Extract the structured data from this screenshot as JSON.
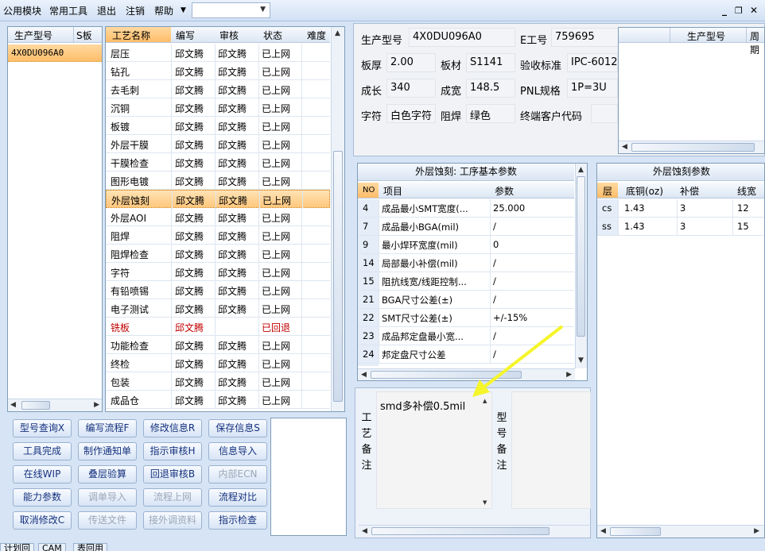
{
  "menubar": {
    "items": [
      "公用模块",
      "常用工具",
      "退出",
      "注销",
      "帮助"
    ],
    "combo_value": ""
  },
  "product_list": {
    "headers": [
      "生产型号",
      "S板"
    ],
    "items": [
      "4X0DU096A0"
    ]
  },
  "process_table": {
    "headers": [
      "工艺名称",
      "编写",
      "审核",
      "状态",
      "难度"
    ],
    "rows": [
      {
        "name": "层压",
        "writer": "邱文腾",
        "reviewer": "邱文腾",
        "status": "已上网"
      },
      {
        "name": "钻孔",
        "writer": "邱文腾",
        "reviewer": "邱文腾",
        "status": "已上网"
      },
      {
        "name": "去毛刺",
        "writer": "邱文腾",
        "reviewer": "邱文腾",
        "status": "已上网"
      },
      {
        "name": "沉铜",
        "writer": "邱文腾",
        "reviewer": "邱文腾",
        "status": "已上网"
      },
      {
        "name": "板镀",
        "writer": "邱文腾",
        "reviewer": "邱文腾",
        "status": "已上网"
      },
      {
        "name": "外层干膜",
        "writer": "邱文腾",
        "reviewer": "邱文腾",
        "status": "已上网"
      },
      {
        "name": "干膜检查",
        "writer": "邱文腾",
        "reviewer": "邱文腾",
        "status": "已上网"
      },
      {
        "name": "图形电镀",
        "writer": "邱文腾",
        "reviewer": "邱文腾",
        "status": "已上网"
      },
      {
        "name": "外层蚀刻",
        "writer": "邱文腾",
        "reviewer": "邱文腾",
        "status": "已上网"
      },
      {
        "name": "外层AOI",
        "writer": "邱文腾",
        "reviewer": "邱文腾",
        "status": "已上网"
      },
      {
        "name": "阻焊",
        "writer": "邱文腾",
        "reviewer": "邱文腾",
        "status": "已上网"
      },
      {
        "name": "阻焊检查",
        "writer": "邱文腾",
        "reviewer": "邱文腾",
        "status": "已上网"
      },
      {
        "name": "字符",
        "writer": "邱文腾",
        "reviewer": "邱文腾",
        "status": "已上网"
      },
      {
        "name": "有铅喷锡",
        "writer": "邱文腾",
        "reviewer": "邱文腾",
        "status": "已上网"
      },
      {
        "name": "电子测试",
        "writer": "邱文腾",
        "reviewer": "邱文腾",
        "status": "已上网"
      },
      {
        "name": "铣板",
        "writer": "邱文腾",
        "reviewer": "",
        "status": "已回退"
      },
      {
        "name": "功能检查",
        "writer": "邱文腾",
        "reviewer": "邱文腾",
        "status": "已上网"
      },
      {
        "name": "终检",
        "writer": "邱文腾",
        "reviewer": "邱文腾",
        "status": "已上网"
      },
      {
        "name": "包装",
        "writer": "邱文腾",
        "reviewer": "邱文腾",
        "status": "已上网"
      },
      {
        "name": "成品仓",
        "writer": "邱文腾",
        "reviewer": "邱文腾",
        "status": "已上网"
      }
    ],
    "selected_index": 8,
    "rollback_index": 15
  },
  "buttons": [
    [
      "型号查询X",
      "编写流程F",
      "修改信息R",
      "保存信息S"
    ],
    [
      "工具完成",
      "制作通知单",
      "指示审核H",
      "信息导入"
    ],
    [
      "在线WIP",
      "叠层验算",
      "回退审核B",
      "内部ECN"
    ],
    [
      "能力参数",
      "调单导入",
      "流程上网",
      "流程对比"
    ],
    [
      "取消修改C",
      "传送文件",
      "接外调资料",
      "指示检查"
    ]
  ],
  "disabled_buttons": [
    "内部ECN",
    "调单导入",
    "流程上网",
    "传送文件",
    "接外调资料"
  ],
  "info": {
    "model_label": "生产型号",
    "model_value": "4X0DU096A0",
    "eno_label": "E工号",
    "eno_value": "759695",
    "thickness_label": "板厚",
    "thickness_value": "2.00",
    "material_label": "板材",
    "material_value": "S1141",
    "standard_label": "验收标准",
    "standard_value": "IPC-6012",
    "length_label": "成长",
    "length_value": "340",
    "width_label": "成宽",
    "width_value": "148.5",
    "pnl_label": "PNL规格",
    "pnl_value": "1P=3U",
    "char_label": "字符",
    "char_value": "白色字符",
    "mask_label": "阻焊",
    "mask_value": "绿色",
    "customer_label": "终端客户代码",
    "customer_value": ""
  },
  "mini_table": {
    "headers": [
      "生产型号",
      "周期"
    ]
  },
  "etch_params": {
    "title": "外层蚀刻: 工序基本参数",
    "headers": [
      "NO",
      "项目",
      "参数"
    ],
    "rows": [
      {
        "no": "4",
        "item": "成品最小SMT宽度(...",
        "param": "25.000"
      },
      {
        "no": "7",
        "item": "成品最小BGA(mil)",
        "param": "/"
      },
      {
        "no": "9",
        "item": "最小焊环宽度(mil)",
        "param": "0"
      },
      {
        "no": "14",
        "item": "局部最小补偿(mil)",
        "param": "/"
      },
      {
        "no": "15",
        "item": "阻抗线宽/线距控制...",
        "param": "/"
      },
      {
        "no": "21",
        "item": "BGA尺寸公差(±)",
        "param": "/"
      },
      {
        "no": "22",
        "item": "SMT尺寸公差(±)",
        "param": "+/-15%"
      },
      {
        "no": "23",
        "item": "成品邦定盘最小宽...",
        "param": "/"
      },
      {
        "no": "24",
        "item": "邦定盘尺寸公差",
        "param": "/"
      }
    ]
  },
  "etch_layer": {
    "title": "外层蚀刻参数",
    "headers": [
      "层",
      "底铜(oz)",
      "补偿",
      "线宽"
    ],
    "rows": [
      {
        "layer": "cs",
        "copper": "1.43",
        "comp": "3",
        "width": "12"
      },
      {
        "layer": "ss",
        "copper": "1.43",
        "comp": "3",
        "width": "15"
      }
    ]
  },
  "notes": {
    "process_label": [
      "工",
      "艺",
      "备",
      "注"
    ],
    "process_text": "smd多补偿0.5mil",
    "model_label": [
      "型",
      "号",
      "备",
      "注"
    ]
  },
  "bottom_tabs": [
    "计划回",
    "CAM",
    "表回用"
  ],
  "colors": {
    "selected_row": "#ffc77d",
    "rollback_text": "#c00000",
    "arrow": "#f5f52a"
  }
}
